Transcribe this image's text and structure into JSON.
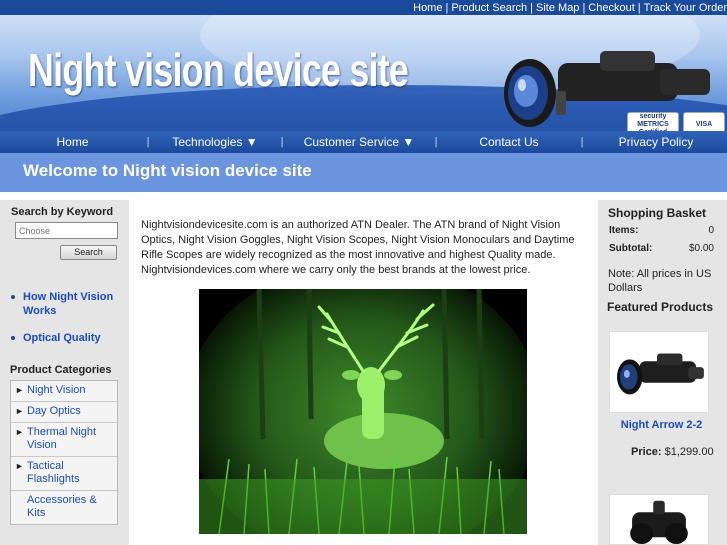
{
  "top_links": [
    "Home",
    "Product Search",
    "Site Map",
    "Checkout",
    "Track Your Order"
  ],
  "banner": {
    "title": "Night vision device site",
    "badges": [
      "security METRICS Certified",
      "VISA"
    ]
  },
  "nav": {
    "items": [
      {
        "label": "Home"
      },
      {
        "label": "Technologies ▼"
      },
      {
        "label": "Customer Service ▼"
      },
      {
        "label": "Contact Us"
      },
      {
        "label": "Privacy Policy"
      }
    ],
    "separator": "|"
  },
  "welcome": {
    "heading": "Welcome to Night vision device site"
  },
  "left": {
    "search_title": "Search by Keyword",
    "search_placeholder": "Choose",
    "search_button": "Search",
    "links": [
      "How Night Vision Works",
      "Optical Quality"
    ],
    "categories_title": "Product Categories",
    "categories": [
      {
        "label": "Night Vision",
        "arrow": true
      },
      {
        "label": "Day Optics",
        "arrow": true
      },
      {
        "label": "Thermal Night Vision",
        "arrow": true
      },
      {
        "label": "Tactical Flashlights",
        "arrow": true
      },
      {
        "label": "Accessories & Kits",
        "arrow": false
      }
    ]
  },
  "main": {
    "intro": "Nightvisiondevicesite.com is an authorized ATN Dealer. The ATN brand of Night Vision Optics, Night Vision Goggles, Night Vision Scopes, Night Vision Monoculars and Daytime Rifle Scopes are widely recognized as the most innovative and highest Quality made. Nightvisiondevices.com where we carry only the best brands at the lowest price."
  },
  "right": {
    "basket_title": "Shopping Basket",
    "items_label": "Items:",
    "items_value": "0",
    "subtotal_label": "Subtotal:",
    "subtotal_value": "$0.00",
    "note": "Note: All prices in US Dollars",
    "featured_title": "Featured Products",
    "products": [
      {
        "name": "Night Arrow 2-2",
        "price_label": "Price:",
        "price": "$1,299.00"
      }
    ]
  },
  "colors": {
    "link": "#1a4cb8",
    "nav_bg": "#1c4a9c",
    "welcome_bg": "#6b95de",
    "sidebar_bg": "#e5e5e5"
  }
}
